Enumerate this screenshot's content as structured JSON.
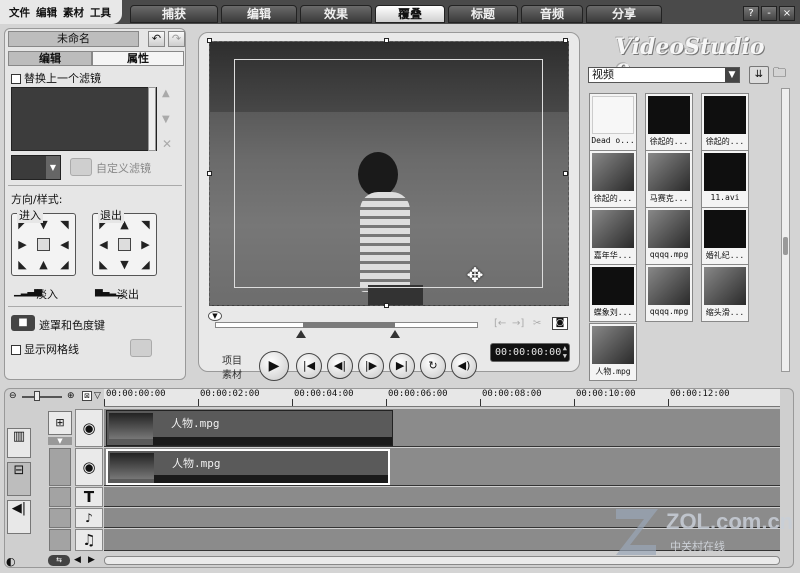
{
  "menu": [
    "文件",
    "编辑",
    "素材",
    "工具"
  ],
  "steps": [
    "捕获",
    "编辑",
    "效果",
    "覆叠",
    "标题",
    "音频",
    "分享"
  ],
  "active_step": "覆叠",
  "window_buttons": [
    "?",
    "-",
    "×"
  ],
  "brand": "VideoStudio 9",
  "left_panel": {
    "project_name": "未命名",
    "tabs": [
      "编辑",
      "属性"
    ],
    "active_tab": "属性",
    "replace_filter_label": "替换上一个滤镜",
    "custom_filter_label": "自定义滤镜",
    "direction_style_label": "方向/样式:",
    "enter_label": "进入",
    "exit_label": "退出",
    "fade_in_label": "淡入",
    "fade_out_label": "淡出",
    "mask_label": "遮罩和色度键",
    "grid_label": "显示网格线"
  },
  "preview": {
    "mode_project": "项目",
    "mode_clip": "素材",
    "timecode": "00:00:00:00"
  },
  "library": {
    "category": "视频",
    "items": [
      {
        "caption": "Dead o...",
        "tone": "light"
      },
      {
        "caption": "徐起的...",
        "tone": "dark"
      },
      {
        "caption": "徐起的...",
        "tone": "dark"
      },
      {
        "caption": "徐起的...",
        "tone": "mid"
      },
      {
        "caption": "马赛克...",
        "tone": "mid"
      },
      {
        "caption": "11.avi",
        "tone": "dark"
      },
      {
        "caption": "嘉年华...",
        "tone": "mid"
      },
      {
        "caption": "qqqq.mpg",
        "tone": "mid"
      },
      {
        "caption": "婚礼纪...",
        "tone": "dark"
      },
      {
        "caption": "蝶象刘...",
        "tone": "dark"
      },
      {
        "caption": "qqqq.mpg",
        "tone": "mid"
      },
      {
        "caption": "缩头滑...",
        "tone": "mid"
      },
      {
        "caption": "人物.mpg",
        "tone": "mid"
      }
    ]
  },
  "timeline": {
    "ticks": [
      "00:00:00:00",
      "00:00:02:00",
      "00:00:04:00",
      "00:00:06:00",
      "00:00:08:00",
      "00:00:10:00",
      "00:00:12:00"
    ],
    "video_clip": "人物.mpg",
    "overlay_clip": "人物.mpg"
  },
  "watermark": {
    "domain": "ZOL.com.cn",
    "tagline": "中关村在线"
  }
}
